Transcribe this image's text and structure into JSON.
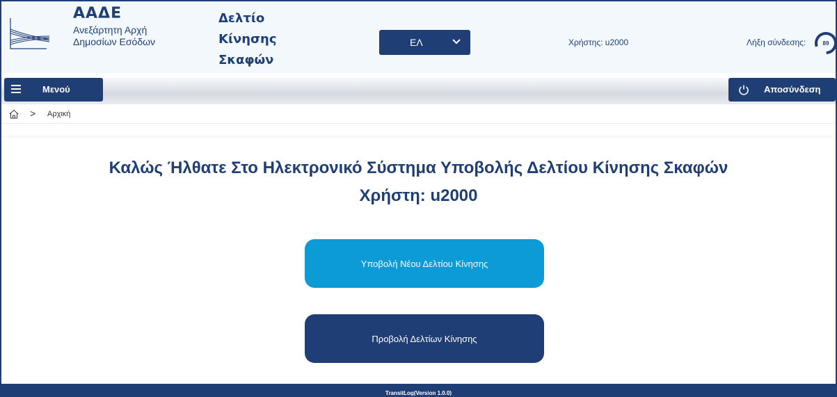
{
  "header": {
    "brand_title": "ΑΑΔΕ",
    "brand_sub_line1": "Ανεξάρτητη Αρχή",
    "brand_sub_line2": "Δημοσίων Εσόδων",
    "app_title_line1": "Δελτίο",
    "app_title_line2": "Κίνησης",
    "app_title_line3": "Σκαφών",
    "language_selected": "ΕΛ",
    "user_label": "Χρήστης: u2000",
    "session_label": "Λήξη σύνδεσης:",
    "session_timer_value": "89"
  },
  "navbar": {
    "menu_label": "Μενού",
    "logout_label": "Αποσύνδεση"
  },
  "breadcrumb": {
    "items": [
      "Αρχική"
    ]
  },
  "main": {
    "welcome_line1": "Καλώς Ήλθατε Στο Ηλεκτρονικό Σύστημα Υποβολής Δελτίου Κίνησης Σκαφών",
    "welcome_line2": "Χρήστη: u2000",
    "new_bulletin_button": "Υποβολή Νέου Δελτίου Κίνησης",
    "view_bulletins_button": "Προβολή Δελτίων Κίνησης"
  },
  "footer": {
    "version_text": "TransitLog(Version 1.0.0)"
  },
  "colors": {
    "primary": "#1f3e75",
    "accent": "#0c9bd6",
    "header_bg": "#f2f8fc"
  }
}
